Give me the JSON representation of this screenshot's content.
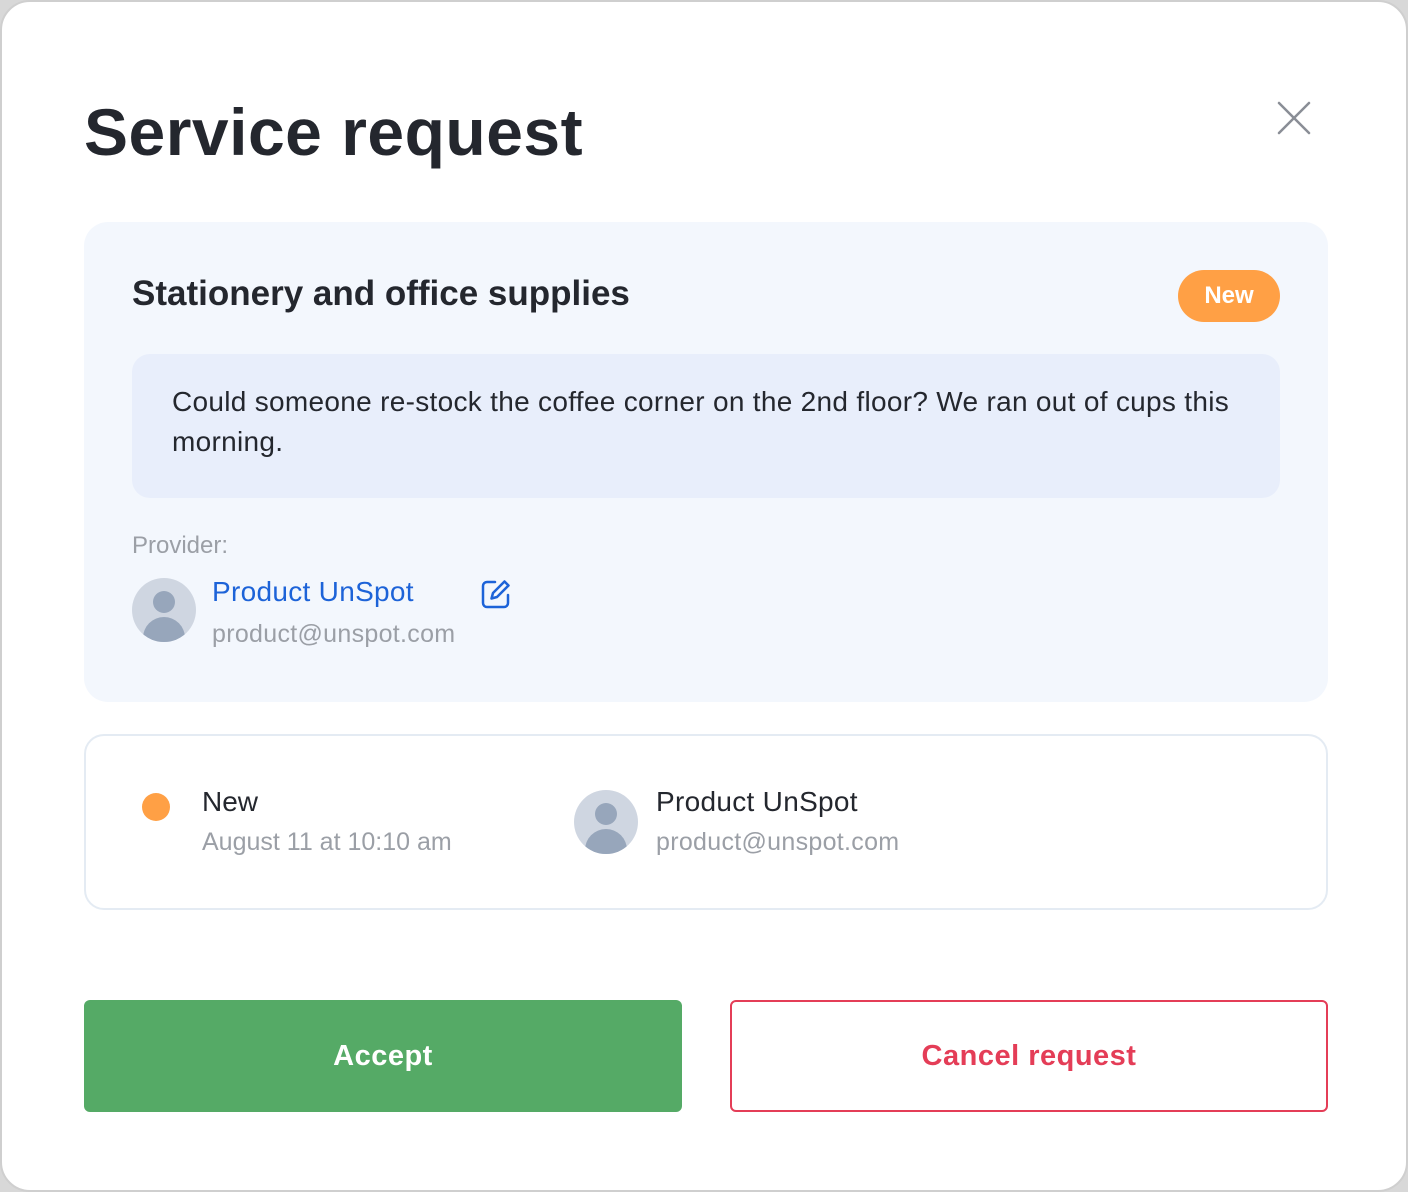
{
  "modal": {
    "title": "Service request"
  },
  "request": {
    "category": "Stationery and office supplies",
    "status_badge": "New",
    "message": "Could someone re-stock the coffee corner on the 2nd floor? We ran out of cups this morning.",
    "provider_label": "Provider:",
    "provider": {
      "name": "Product UnSpot",
      "email": "product@unspot.com"
    }
  },
  "history": {
    "status": "New",
    "date": "August 11 at 10:10 am",
    "status_color": "#ffa045",
    "user": {
      "name": "Product UnSpot",
      "email": "product@unspot.com"
    }
  },
  "actions": {
    "accept_label": "Accept",
    "cancel_label": "Cancel request"
  },
  "colors": {
    "accent_green": "#55aa66",
    "danger_red": "#e43d57",
    "badge_orange": "#ffa045",
    "link_blue": "#1d63d8"
  },
  "icons": {
    "close": "close-icon",
    "edit": "edit-icon",
    "avatar": "user-avatar-icon"
  }
}
